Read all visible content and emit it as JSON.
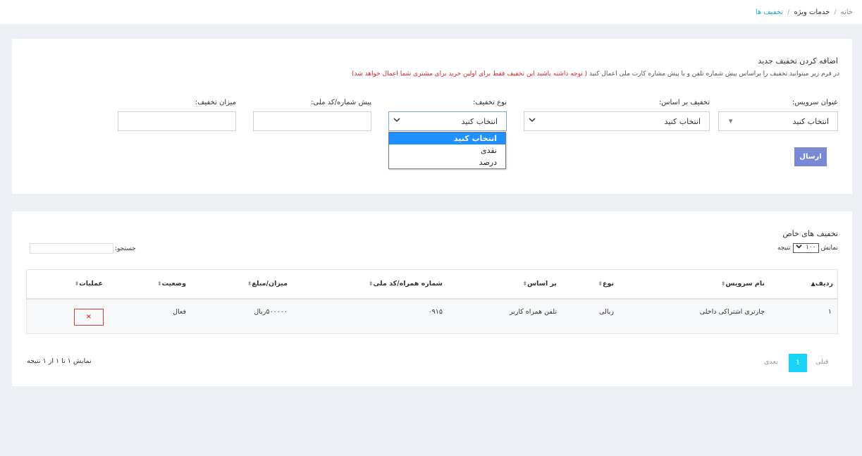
{
  "breadcrumb": {
    "home": "خانه",
    "section": "خدمات ویژه",
    "current": "تخفیف ها",
    "separator": "/"
  },
  "add_form": {
    "title": "اضافه کردن تخفیف جدید",
    "description": "در فرم زیر میتوانید تخفیف را براساس پیش شماره تلفن و یا پیش مشاره کارت ملی اعمال کنید",
    "warning": "( توجه داشته باشید این تخفیف فقط برای اولین خرید برای مشتری شما اعمال خواهد شد)",
    "service_label": "عنوان سرویس:",
    "service_value": "انتخاب کنید",
    "basis_label": "تخفیف بر اساس:",
    "basis_value": "انتخاب کنید",
    "type_label": "نوع تخفیف:",
    "type_value": "انتخاب کنید",
    "type_options": [
      "انتخاب کنید",
      "نقدی",
      "درصد"
    ],
    "prefix_label": "پیش شماره/کد ملی:",
    "prefix_value": "",
    "amount_label": "میزان تخفیف:",
    "amount_value": "",
    "submit_label": "ارسال"
  },
  "table_section": {
    "title": "تخفیف های خاص",
    "show_prefix": "نمایش",
    "show_value": "۱۰۰",
    "show_suffix": "نتیجه",
    "search_label": "جستجو:",
    "search_value": "",
    "columns": {
      "row": "ردیف",
      "service": "نام سرویس",
      "type": "نوع",
      "basis": "بر اساس",
      "prefix": "شماره همراه/کد ملی",
      "amount": "میزان/مبلغ",
      "status": "وضعیت",
      "actions": "عملیات"
    },
    "rows": [
      {
        "row": "۱",
        "service": "چارتری اشتراکی داخلی",
        "type": "ریالی",
        "basis": "تلفن همراه کاربر",
        "prefix": "۰۹۱۵",
        "amount": "۵۰۰۰۰۰ریال",
        "status": "فعال",
        "action_icon": "×"
      }
    ],
    "info": "نمایش ۱ تا ۱ از ۱ نتیجه",
    "pager": {
      "prev": "قبلی",
      "current": "1",
      "next": "بعدی"
    }
  }
}
